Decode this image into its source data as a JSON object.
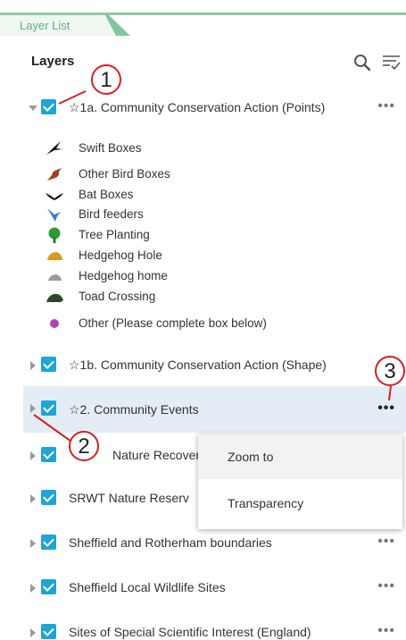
{
  "panel": {
    "tab_label": "Layer List",
    "heading": "Layers"
  },
  "toolbar": {
    "search_icon": "search-icon",
    "filter_icon": "filter-list-icon"
  },
  "layers": [
    {
      "label": "☆1a. Community Conservation Action (Points)",
      "checked": true,
      "expanded": true,
      "more": "•••"
    },
    {
      "label": "☆1b. Community Conservation Action (Shape)",
      "checked": true,
      "expanded": false,
      "more": ""
    },
    {
      "label": "☆2. Community Events",
      "checked": true,
      "expanded": false,
      "more": "•••",
      "highlighted": true
    },
    {
      "label": "Nature Recovery",
      "checked": true,
      "expanded": false,
      "more": ""
    },
    {
      "label": "SRWT Nature Reserv",
      "checked": true,
      "expanded": false,
      "more": ""
    },
    {
      "label": "Sheffield and Rotherham boundaries",
      "checked": true,
      "expanded": false,
      "more": "•••"
    },
    {
      "label": "Sheffield Local Wildlife Sites",
      "checked": true,
      "expanded": false,
      "more": "•••"
    },
    {
      "label": "Sites of Special Scientific Interest (England)",
      "checked": true,
      "expanded": false,
      "more": "•••"
    }
  ],
  "legend": [
    {
      "label": "Swift Boxes",
      "icon": "swift-icon",
      "color": "#111111"
    },
    {
      "label": "Other Bird Boxes",
      "icon": "bird-icon",
      "color": "#a0401c"
    },
    {
      "label": "Bat Boxes",
      "icon": "bat-icon",
      "color": "#111111"
    },
    {
      "label": "Bird feeders",
      "icon": "bird-feeder-icon",
      "color": "#3a7fc9"
    },
    {
      "label": "Tree Planting",
      "icon": "tree-icon",
      "color": "#2e9a2e"
    },
    {
      "label": "Hedgehog Hole",
      "icon": "hedgehog-icon",
      "color": "#d99a1e"
    },
    {
      "label": "Hedgehog home",
      "icon": "hedgehog-home-icon",
      "color": "#9a9a9a"
    },
    {
      "label": "Toad Crossing",
      "icon": "toad-icon",
      "color": "#2c4a2c"
    },
    {
      "label": "Other (Please complete box below)",
      "icon": "circle-icon",
      "color": "#b044b6"
    }
  ],
  "context_menu": {
    "items": [
      "Zoom to",
      "Transparency"
    ]
  },
  "callouts": [
    "1",
    "2",
    "3"
  ],
  "colors": {
    "accent": "#1fa4d6",
    "tab": "#7fc69c",
    "callout": "#d52020"
  }
}
